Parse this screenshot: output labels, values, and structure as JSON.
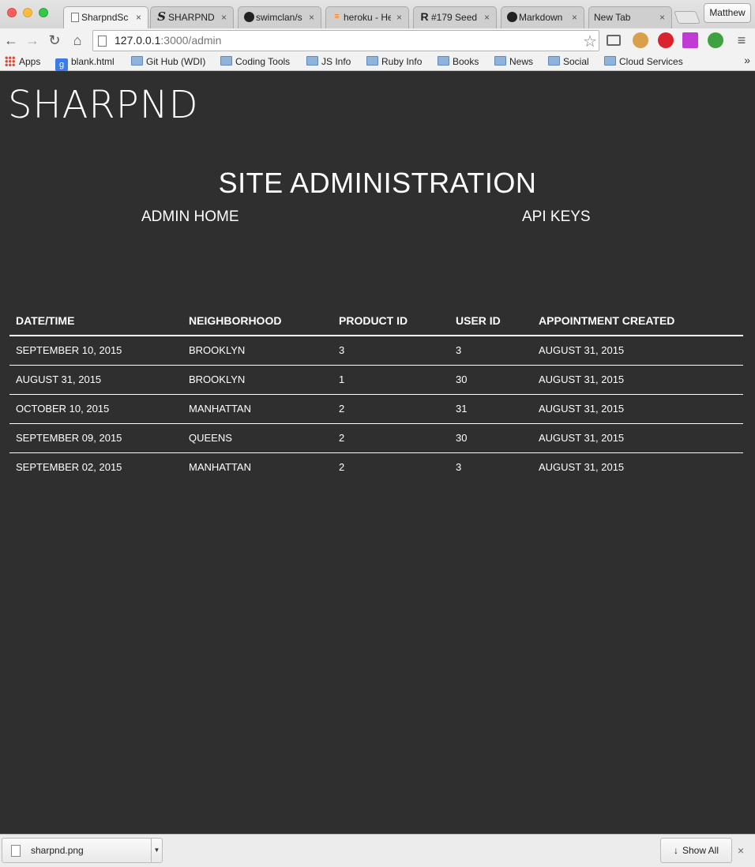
{
  "browser": {
    "tabs": [
      {
        "icon": "page-icon",
        "title": "SharpndSc",
        "active": true
      },
      {
        "icon": "sharpnd-s-icon",
        "title": "SHARPND",
        "active": false
      },
      {
        "icon": "github-icon",
        "title": "swimclan/s",
        "active": false
      },
      {
        "icon": "stack-icon",
        "title": "heroku - He",
        "active": false
      },
      {
        "icon": "railscasts-icon",
        "title": "#179 Seed",
        "active": false
      },
      {
        "icon": "github-icon",
        "title": "Markdown",
        "active": false
      },
      {
        "icon": "",
        "title": "New Tab",
        "active": false
      }
    ],
    "tab_close_glyph": "×",
    "profile_name": "Matthew",
    "url_host": "127.0.0.1",
    "url_path": ":3000/admin",
    "bookmarks": [
      {
        "icon": "apps-icon",
        "label": "Apps"
      },
      {
        "icon": "google-icon",
        "label": "blank.html"
      },
      {
        "icon": "folder-icon",
        "label": "Git Hub (WDI)"
      },
      {
        "icon": "folder-icon",
        "label": "Coding Tools"
      },
      {
        "icon": "folder-icon",
        "label": "JS Info"
      },
      {
        "icon": "folder-icon",
        "label": "Ruby Info"
      },
      {
        "icon": "folder-icon",
        "label": "Books"
      },
      {
        "icon": "folder-icon",
        "label": "News"
      },
      {
        "icon": "folder-icon",
        "label": "Social"
      },
      {
        "icon": "folder-icon",
        "label": "Cloud Services"
      }
    ],
    "bookmarks_more": "»"
  },
  "page": {
    "logo": "SHARPND",
    "title": "SITE ADMINISTRATION",
    "nav": {
      "admin_home": "ADMIN HOME",
      "api_keys": "API KEYS"
    },
    "table": {
      "headers": [
        "DATE/TIME",
        "NEIGHBORHOOD",
        "PRODUCT ID",
        "USER ID",
        "APPOINTMENT CREATED"
      ],
      "rows": [
        [
          "SEPTEMBER 10, 2015",
          "BROOKLYN",
          "3",
          "3",
          "AUGUST 31, 2015"
        ],
        [
          "AUGUST 31, 2015",
          "BROOKLYN",
          "1",
          "30",
          "AUGUST 31, 2015"
        ],
        [
          "OCTOBER 10, 2015",
          "MANHATTAN",
          "2",
          "31",
          "AUGUST 31, 2015"
        ],
        [
          "SEPTEMBER 09, 2015",
          "QUEENS",
          "2",
          "30",
          "AUGUST 31, 2015"
        ],
        [
          "SEPTEMBER 02, 2015",
          "MANHATTAN",
          "2",
          "3",
          "AUGUST 31, 2015"
        ]
      ]
    }
  },
  "downloads": {
    "file_name": "sharpnd.png",
    "show_all": "Show All",
    "close_glyph": "×"
  },
  "colors": {
    "page_background": "#2f2f2f",
    "text": "#ffffff"
  }
}
